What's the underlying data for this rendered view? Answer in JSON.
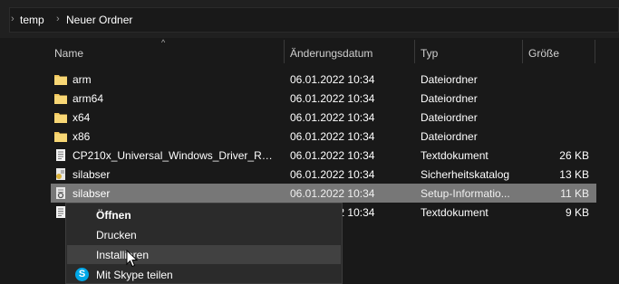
{
  "breadcrumb": {
    "items": [
      "temp",
      "Neuer Ordner"
    ],
    "separator_icon": "chevron-right-icon"
  },
  "columns": {
    "name": "Name",
    "date": "Änderungsdatum",
    "type": "Typ",
    "size": "Größe"
  },
  "files": [
    {
      "name": "arm",
      "date": "06.01.2022 10:34",
      "type": "Dateiordner",
      "size": "",
      "icon": "folder-icon"
    },
    {
      "name": "arm64",
      "date": "06.01.2022 10:34",
      "type": "Dateiordner",
      "size": "",
      "icon": "folder-icon"
    },
    {
      "name": "x64",
      "date": "06.01.2022 10:34",
      "type": "Dateiordner",
      "size": "",
      "icon": "folder-icon"
    },
    {
      "name": "x86",
      "date": "06.01.2022 10:34",
      "type": "Dateiordner",
      "size": "",
      "icon": "folder-icon"
    },
    {
      "name": "CP210x_Universal_Windows_Driver_Relea...",
      "date": "06.01.2022 10:34",
      "type": "Textdokument",
      "size": "26 KB",
      "icon": "text-document-icon"
    },
    {
      "name": "silabser",
      "date": "06.01.2022 10:34",
      "type": "Sicherheitskatalog",
      "size": "13 KB",
      "icon": "security-catalog-icon"
    },
    {
      "name": "silabser",
      "date": "06.01.2022 10:34",
      "type": "Setup-Informatio...",
      "size": "11 KB",
      "icon": "setup-info-icon",
      "selected": true
    },
    {
      "name": "",
      "date": "06.01.2022 10:34",
      "type": "Textdokument",
      "size": "9 KB",
      "icon": "text-document-icon"
    }
  ],
  "context_menu": {
    "items": [
      {
        "label": "Öffnen",
        "bold": true
      },
      {
        "label": "Drucken"
      },
      {
        "label": "Installieren",
        "hovered": true
      },
      {
        "label": "Mit Skype teilen",
        "icon": "skype-icon"
      }
    ]
  },
  "colors": {
    "background": "#191919",
    "selected_row": "#777777",
    "menu_bg": "#2b2b2b",
    "folder": "#f4c95d",
    "skype": "#00a7e7"
  }
}
